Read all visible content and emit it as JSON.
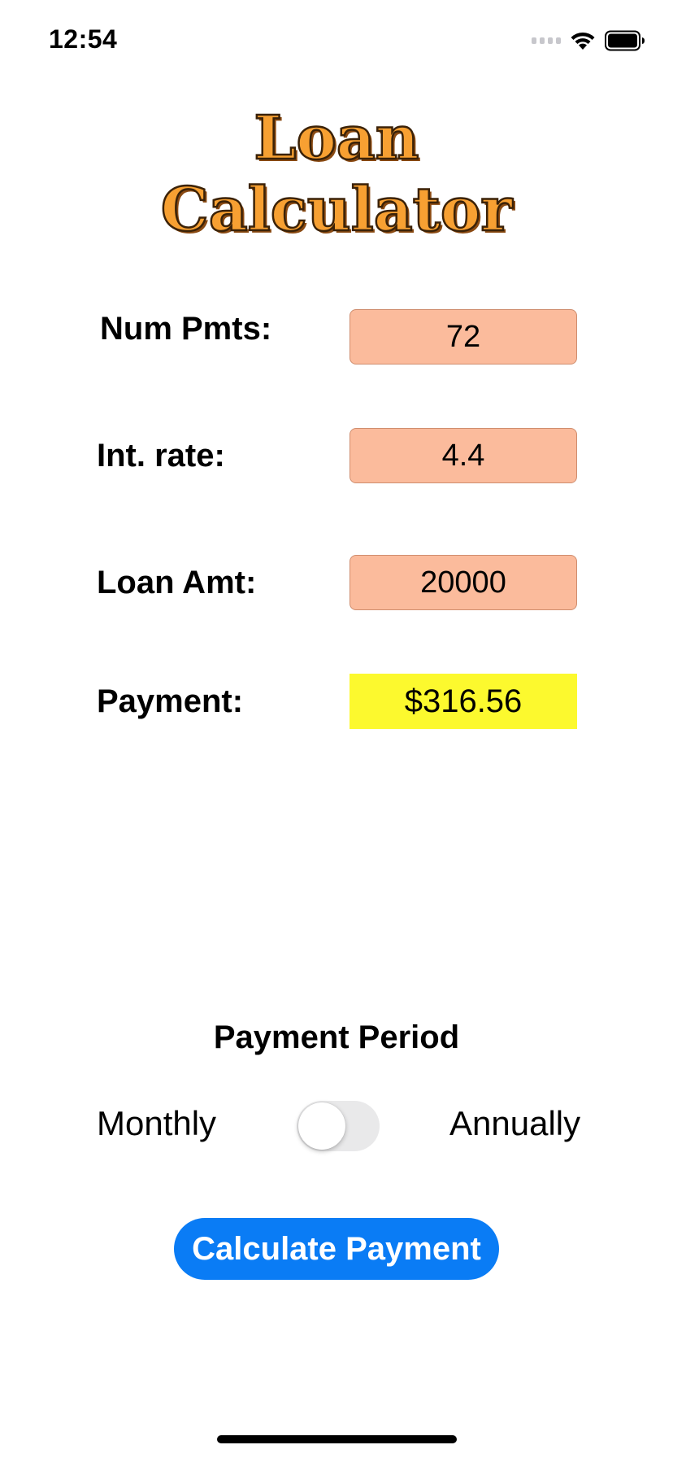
{
  "status_bar": {
    "time": "12:54",
    "icons": [
      "signal-icon",
      "wifi-icon",
      "battery-icon"
    ]
  },
  "app": {
    "title_line1": "Loan",
    "title_line2": "Calculator"
  },
  "form": {
    "num_pmts": {
      "label": "Num Pmts:",
      "value": "72"
    },
    "int_rate": {
      "label": "Int. rate:",
      "value": "4.4"
    },
    "loan_amt": {
      "label": "Loan Amt:",
      "value": "20000"
    },
    "payment": {
      "label": "Payment:",
      "value": "$316.56"
    }
  },
  "payment_period": {
    "title": "Payment Period",
    "left_option": "Monthly",
    "right_option": "Annually",
    "toggle_on": false
  },
  "actions": {
    "calculate_label": "Calculate Payment"
  },
  "colors": {
    "input_bg": "#fbbb9c",
    "result_bg": "#fcf92e",
    "button_bg": "#0a7cf5",
    "title_fill": "#f7a032"
  }
}
